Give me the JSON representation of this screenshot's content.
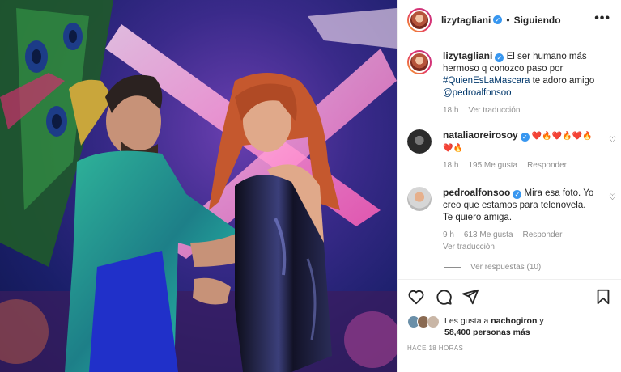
{
  "post_header": {
    "username": "lizytagliani",
    "separator": "•",
    "follow_label": "Siguiendo",
    "more_icon": "more-options-icon"
  },
  "caption": {
    "username": "lizytagliani",
    "text": "El ser humano más hermoso q conozco paso por",
    "hashtag": "#QuienEsLaMascara",
    "text2": "te adoro amigo",
    "mention": "@pedroalfonsoo",
    "time": "18 h",
    "translate": "Ver traducción"
  },
  "comments": [
    {
      "username": "nataliaoreirosoy",
      "text": "❤️🔥❤️🔥❤️🔥❤️🔥",
      "time": "18 h",
      "likes": "195 Me gusta",
      "reply": "Responder"
    },
    {
      "username": "pedroalfonsoo",
      "text": "Mira esa foto. Yo creo que estamos para telenovela. Te quiero amiga.",
      "time": "9 h",
      "likes": "613 Me gusta",
      "reply": "Responder",
      "translate": "Ver traducción"
    }
  ],
  "view_replies": "Ver respuestas (10)",
  "likes": {
    "prefix": "Les gusta a",
    "user": "nachogiron",
    "suffix": "y",
    "count": "58,400 personas más"
  },
  "timestamp": "HACE 18 HORAS"
}
